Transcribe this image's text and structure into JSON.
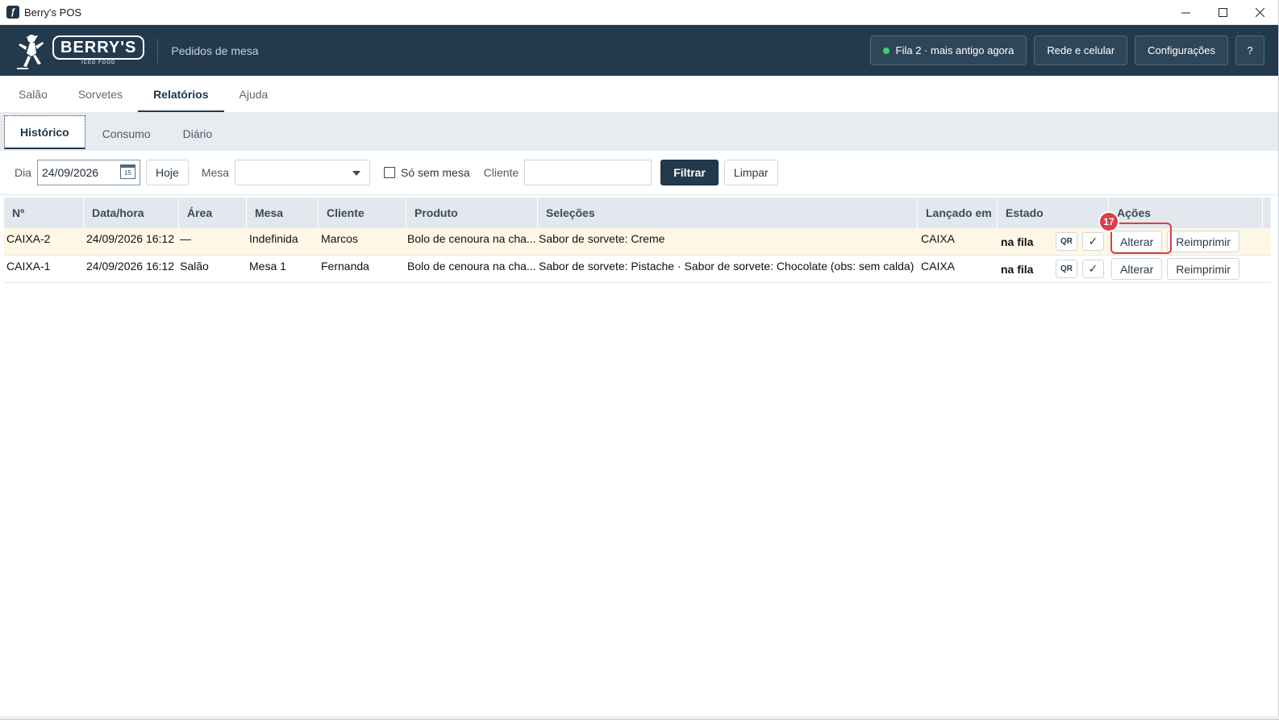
{
  "window": {
    "title": "Berry's POS",
    "app_icon": "app-icon",
    "controls": [
      "minimize-icon",
      "maximize-icon",
      "close-icon"
    ]
  },
  "header": {
    "logo_text": "BERRY'S",
    "logo_subtext": "ICED FOOD",
    "title": "Pedidos de mesa",
    "queue_status": "Fila 2 · mais antigo agora",
    "queue_status_color": "#3dcf6e",
    "network_button": "Rede e celular",
    "settings_button": "Configurações",
    "help_button": "?"
  },
  "main_tabs": [
    {
      "label": "Salão",
      "active": false
    },
    {
      "label": "Sorvetes",
      "active": false
    },
    {
      "label": "Relatórios",
      "active": true
    },
    {
      "label": "Ajuda",
      "active": false
    }
  ],
  "sub_tabs": [
    {
      "label": "Histórico",
      "active": true
    },
    {
      "label": "Consumo",
      "active": false
    },
    {
      "label": "Diário",
      "active": false
    }
  ],
  "filters": {
    "day_label": "Dia",
    "day_value": "24/09/2026",
    "calendar_day": "15",
    "today_button": "Hoje",
    "table_label": "Mesa",
    "table_value": "",
    "no_table_label": "Só sem mesa",
    "no_table_checked": false,
    "client_label": "Cliente",
    "client_value": "",
    "filter_button": "Filtrar",
    "clear_button": "Limpar"
  },
  "table": {
    "columns": [
      "Nº",
      "Data/hora",
      "Área",
      "Mesa",
      "Cliente",
      "Produto",
      "Seleções",
      "Lançado em",
      "Estado",
      "Ações"
    ],
    "rows": [
      {
        "num": "CAIXA-2",
        "datetime": "24/09/2026 16:12",
        "area": "—",
        "table": "Indefinida",
        "client": "Marcos",
        "product": "Bolo de cenoura na cha...",
        "selections": "Sabor de sorvete: Creme",
        "launched": "CAIXA",
        "state": "na fila",
        "qr": "QR",
        "check": "✓",
        "edit": "Alterar",
        "reprint": "Reimprimir",
        "highlighted": true
      },
      {
        "num": "CAIXA-1",
        "datetime": "24/09/2026 16:12",
        "area": "Salão",
        "table": "Mesa 1",
        "client": "Fernanda",
        "product": "Bolo de cenoura na cha...",
        "selections": "Sabor de sorvete: Pistache · Sabor de sorvete: Chocolate (obs: sem calda)",
        "launched": "CAIXA",
        "state": "na fila",
        "qr": "QR",
        "check": "✓",
        "edit": "Alterar",
        "reprint": "Reimprimir",
        "highlighted": false
      }
    ]
  },
  "annotation": {
    "badge": "17",
    "color": "#d9404a"
  }
}
